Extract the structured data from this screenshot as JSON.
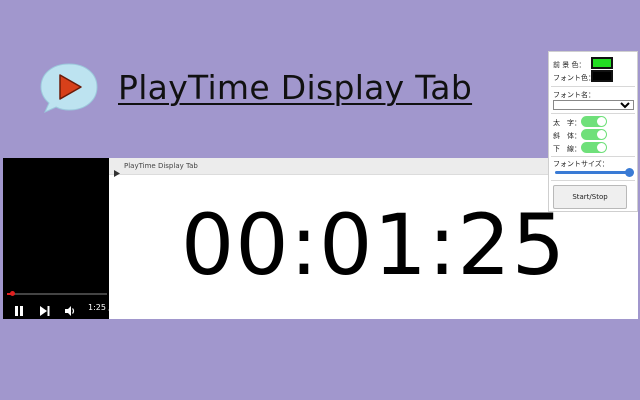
{
  "header": {
    "title": "PlayTime Display Tab",
    "logo_icon": "play-speech-bubble-icon"
  },
  "video": {
    "time_label": "1:25 /",
    "progress": 0.05,
    "icons": [
      "pause-icon",
      "next-icon",
      "volume-icon"
    ],
    "accent": "#e02020"
  },
  "display": {
    "tab_icon": "play-triangle-icon",
    "tab_title": "PlayTime Display Tab",
    "clock": "00:01:25"
  },
  "settings": {
    "fg_color_label": "前 景 色：",
    "fg_color": "#22dd22",
    "font_color_label": "フォント色：",
    "font_color": "#000000",
    "font_name_label": "フォント名：",
    "font_name_value": "",
    "bold_label": "太　字：",
    "italic_label": "斜　体：",
    "underline_label": "下　線：",
    "toggle_color": "#6fe07a",
    "font_size_label": "フォントサイズ：",
    "font_size_level": 1.0,
    "start_stop_label": "Start/Stop"
  }
}
